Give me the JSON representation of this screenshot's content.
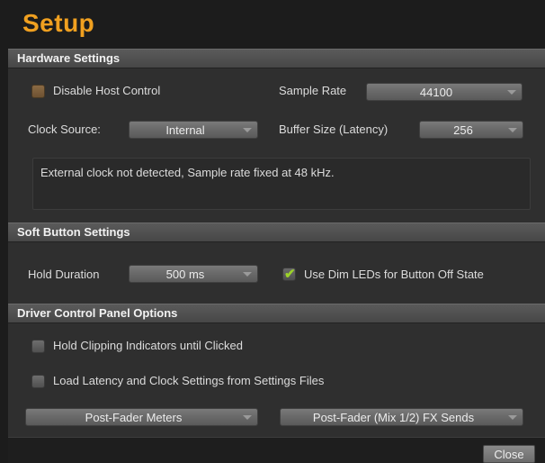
{
  "title": "Setup",
  "hardware": {
    "header": "Hardware Settings",
    "disable_host_control": {
      "label": "Disable Host Control",
      "checked": false
    },
    "sample_rate": {
      "label": "Sample Rate",
      "value": "44100"
    },
    "clock_source": {
      "label": "Clock Source:",
      "value": "Internal"
    },
    "buffer_size": {
      "label": "Buffer Size (Latency)",
      "value": "256"
    },
    "message": "External clock not detected,  Sample rate fixed at 48 kHz."
  },
  "soft_button": {
    "header": "Soft Button Settings",
    "hold_duration": {
      "label": "Hold Duration",
      "value": "500 ms"
    },
    "dim_leds": {
      "label": "Use Dim LEDs for Button Off State",
      "checked": true
    }
  },
  "driver": {
    "header": "Driver Control Panel Options",
    "hold_clipping": {
      "label": "Hold Clipping Indicators until Clicked",
      "checked": false
    },
    "load_latency": {
      "label": "Load Latency and Clock Settings from Settings Files",
      "checked": false
    },
    "meters": {
      "value": "Post-Fader Meters"
    },
    "fx_sends": {
      "value": "Post-Fader (Mix 1/2) FX Sends"
    }
  },
  "close_label": "Close",
  "colors": {
    "accent": "#f0a020",
    "check": "#9cd22a"
  }
}
